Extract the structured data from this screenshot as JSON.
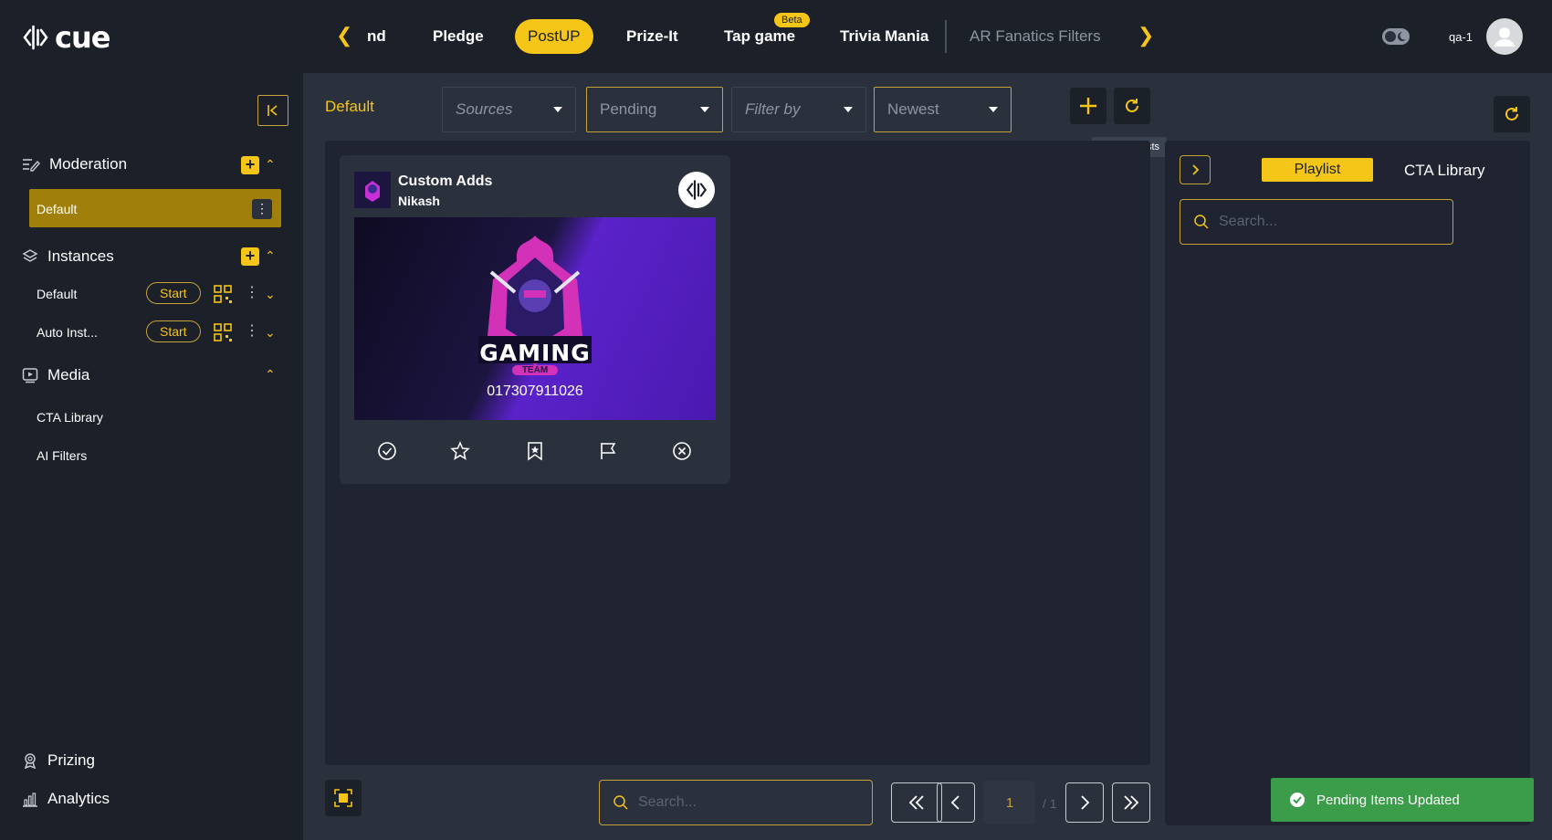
{
  "brand": {
    "name": "cue"
  },
  "nav": {
    "tabs": [
      {
        "label": "nd"
      },
      {
        "label": "Pledge"
      },
      {
        "label": "PostUP"
      },
      {
        "label": "Prize-It"
      },
      {
        "label": "Tap game",
        "badge": "Beta"
      },
      {
        "label": "Trivia Mania"
      },
      {
        "label": "AR Fanatics Filters"
      }
    ],
    "active": "PostUP"
  },
  "user": {
    "name": "qa-1"
  },
  "sidebar": {
    "moderation": {
      "label": "Moderation",
      "items": [
        {
          "label": "Default"
        }
      ]
    },
    "instances": {
      "label": "Instances",
      "items": [
        {
          "label": "Default",
          "action": "Start"
        },
        {
          "label": "Auto Inst...",
          "action": "Start"
        }
      ]
    },
    "media": {
      "label": "Media",
      "items": [
        {
          "label": "CTA Library"
        },
        {
          "label": "AI Filters"
        }
      ]
    },
    "prizing": {
      "label": "Prizing"
    },
    "analytics": {
      "label": "Analytics"
    }
  },
  "toolbar": {
    "title": "Default",
    "filters": {
      "sources": "Sources",
      "status": "Pending",
      "filter_by": "Filter by",
      "sort": "Newest"
    },
    "tooltip": "Update Posts"
  },
  "post": {
    "title": "Custom Adds",
    "author": "Nikash",
    "image_caption": "017307911026",
    "logo_text": "GAMING",
    "logo_subtext": "TEAM"
  },
  "right_panel": {
    "tabs": {
      "playlist": "Playlist",
      "cta": "CTA Library"
    },
    "search_placeholder": "Search..."
  },
  "footer": {
    "search_placeholder": "Search...",
    "page": "1",
    "total": "/ 1"
  },
  "toast": {
    "message": "Pending Items Updated"
  },
  "colors": {
    "accent": "#f5c518",
    "success": "#3b9c4a",
    "bg": "#1b2029",
    "panel": "#2a303c"
  }
}
